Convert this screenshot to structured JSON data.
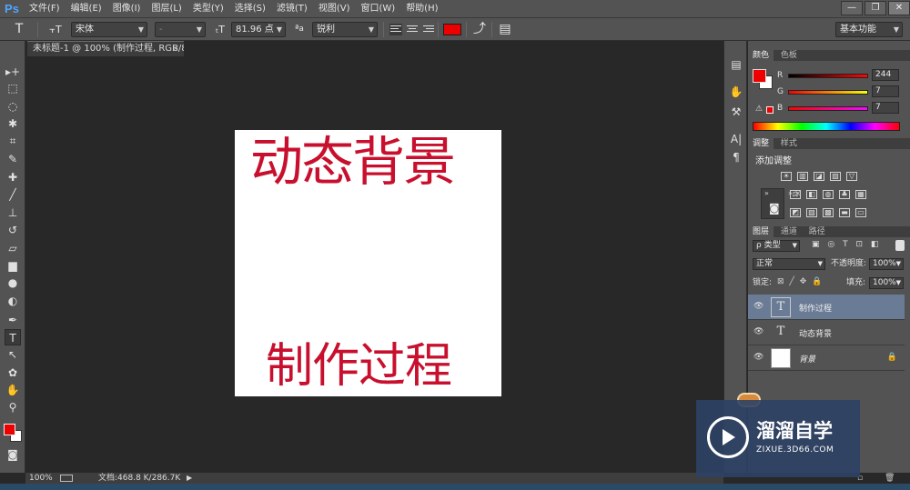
{
  "app": {
    "logo": "Ps"
  },
  "menu": [
    "文件(F)",
    "编辑(E)",
    "图像(I)",
    "图层(L)",
    "类型(Y)",
    "选择(S)",
    "滤镜(T)",
    "视图(V)",
    "窗口(W)",
    "帮助(H)"
  ],
  "window_controls": {
    "minimize": "—",
    "restore": "❐",
    "close": "✕"
  },
  "options": {
    "tool_glyph": "T",
    "orient_glyph": "⫟T",
    "font_family": "宋体",
    "font_style": "-",
    "size_glyph": "ₜT",
    "font_size": "81.96 点",
    "aa_glyph": "ªa",
    "antialias": "锐利",
    "text_color": "#ef0000",
    "workspace": "基本功能"
  },
  "document_tab": {
    "title": "未标题-1 @ 100% (制作过程, RGB/8) *",
    "close": "×"
  },
  "canvas": {
    "text_top": "动态背景",
    "text_bottom": "制作过程",
    "text_color": "#c8102e"
  },
  "tools": [
    {
      "glyph": "▸+",
      "name": "move-tool-icon"
    },
    {
      "glyph": "⬚",
      "name": "marquee-tool-icon"
    },
    {
      "glyph": "◌",
      "name": "lasso-tool-icon"
    },
    {
      "glyph": "✱",
      "name": "quick-select-tool-icon"
    },
    {
      "glyph": "⌗",
      "name": "crop-tool-icon"
    },
    {
      "glyph": "✎",
      "name": "eyedropper-tool-icon"
    },
    {
      "glyph": "✚",
      "name": "healing-brush-tool-icon"
    },
    {
      "glyph": "╱",
      "name": "brush-tool-icon"
    },
    {
      "glyph": "⊥",
      "name": "stamp-tool-icon"
    },
    {
      "glyph": "↺",
      "name": "history-brush-tool-icon"
    },
    {
      "glyph": "▱",
      "name": "eraser-tool-icon"
    },
    {
      "glyph": "▆",
      "name": "gradient-tool-icon"
    },
    {
      "glyph": "●",
      "name": "blur-tool-icon"
    },
    {
      "glyph": "◐",
      "name": "dodge-tool-icon"
    },
    {
      "glyph": "✒",
      "name": "pen-tool-icon"
    },
    {
      "glyph": "T",
      "name": "type-tool-icon"
    },
    {
      "glyph": "↖",
      "name": "path-select-tool-icon"
    },
    {
      "glyph": "✿",
      "name": "shape-tool-icon"
    },
    {
      "glyph": "✋",
      "name": "hand-tool-icon"
    },
    {
      "glyph": "⚲",
      "name": "zoom-tool-icon"
    }
  ],
  "mode_glyph": "◙",
  "status": {
    "zoom": "100%",
    "doc_size": "文档:468.8 K/286.7K",
    "arrow": "▶"
  },
  "color_panel": {
    "tabs": [
      "颜色",
      "色板"
    ],
    "r_label": "R",
    "g_label": "G",
    "b_label": "B",
    "r": "244",
    "g": "7",
    "b": "7",
    "fg": "#ef0000"
  },
  "adjust_panel": {
    "tabs": [
      "调整",
      "样式"
    ],
    "title": "添加调整",
    "row1": [
      "☀",
      "▥",
      "◪",
      "▨",
      "▽"
    ],
    "row2": [
      "⚖",
      "◧",
      "◍",
      "♣",
      "▦"
    ],
    "row3": [
      "◩",
      "▨",
      "▩",
      "▬",
      "▭"
    ]
  },
  "layers_panel": {
    "tabs": [
      "图层",
      "通道",
      "路径"
    ],
    "filter_label": "ρ 类型",
    "filter_icons": [
      "▣",
      "◎",
      "T",
      "⊡",
      "◧"
    ],
    "blend_mode": "正常",
    "opacity_label": "不透明度:",
    "opacity": "100%",
    "lock_label": "锁定:",
    "lock_icons": [
      "⊠",
      "╱",
      "✥",
      "🔒"
    ],
    "fill_label": "填充:",
    "fill": "100%",
    "layers": [
      {
        "name": "制作过程",
        "thumb": "T",
        "eye": "👁",
        "selected": true
      },
      {
        "name": "动态背景",
        "thumb": "T",
        "eye": "👁",
        "selected": false
      },
      {
        "name": "背景",
        "thumb": "",
        "eye": "👁",
        "lock": "🔒",
        "selected": false
      }
    ]
  },
  "watermark": {
    "title": "溜溜自学",
    "url": "ZIXUE.3D66.COM"
  }
}
